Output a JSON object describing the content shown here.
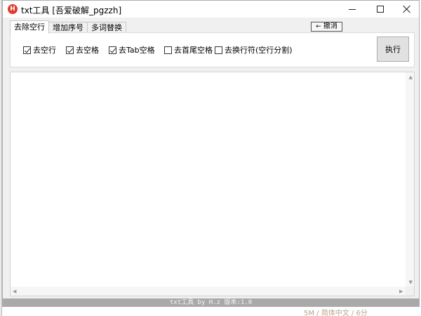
{
  "window": {
    "title": "txt工具 [吾爱破解_pgzzh]",
    "icon": "H",
    "controls": [
      "minimize-icon",
      "maximize-icon",
      "close-icon"
    ]
  },
  "tabs": [
    {
      "label": "去除空行",
      "active": true
    },
    {
      "label": "增加序号",
      "active": false
    },
    {
      "label": "多词替换",
      "active": false
    }
  ],
  "undo_button": {
    "arrow": "←",
    "label": "撤消"
  },
  "options": [
    {
      "label": "去空行",
      "checked": true
    },
    {
      "label": "去空格",
      "checked": true
    },
    {
      "label": "去Tab空格",
      "checked": true
    },
    {
      "label": "去首尾空格",
      "checked": false
    },
    {
      "label": "去换行符(空行分割)",
      "checked": false
    }
  ],
  "execute_button": {
    "label": "执行"
  },
  "editor": {
    "value": ""
  },
  "statusbar": {
    "text": "txt工具 by H.z  版本:1.0"
  },
  "background_fragment": {
    "text": "5M / 简体中文 / 6分"
  },
  "colors": {
    "app_icon": "#e23b2e",
    "statusbar": "#a9a9a9",
    "window_bg": "#f0f0f0"
  }
}
